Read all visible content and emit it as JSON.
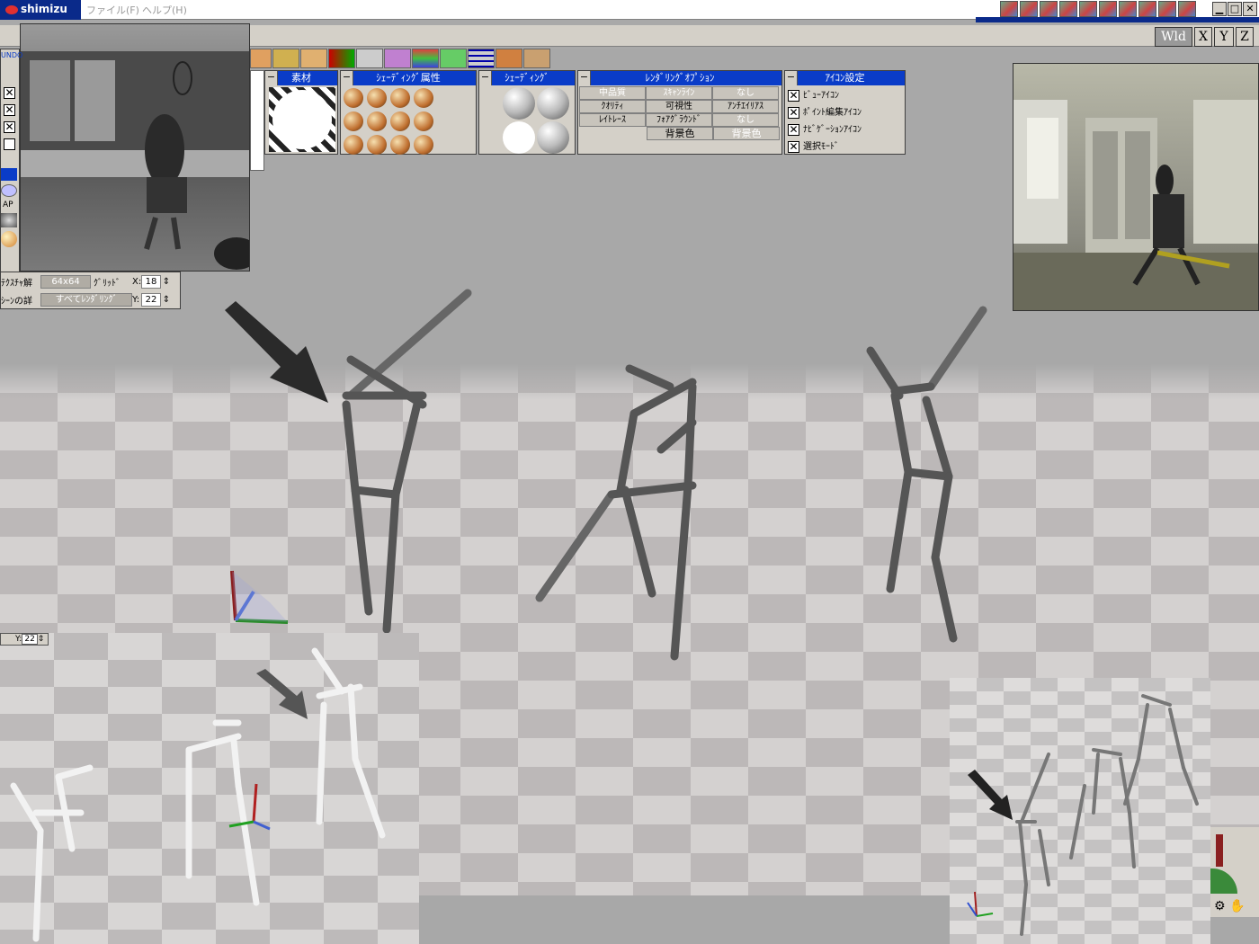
{
  "app": {
    "title": "shimizu"
  },
  "menu": {
    "file": "ファイル(F)",
    "help": "ヘルプ(H)"
  },
  "toolbar": {
    "undo_label": "UNDO",
    "axes": [
      "Wld",
      "X",
      "Y",
      "Z"
    ]
  },
  "panels": {
    "material": {
      "title": "素材"
    },
    "shading_attr": {
      "title": "ｼｪｰﾃﾞｨﾝｸﾞ属性"
    },
    "shading": {
      "title": "ｼｪｰﾃﾞｨﾝｸﾞ"
    },
    "render_options": {
      "title": "ﾚﾝﾀﾞﾘﾝｸﾞｵﾌﾟｼｮﾝ",
      "row1": [
        "中品質",
        "ｽｷｬﾝﾗｲﾝ",
        "なし"
      ],
      "row2": [
        "ｸｵﾘﾃｨ",
        "可視性",
        "ｱﾝﾁｴｲﾘｱｽ"
      ],
      "row3": [
        "ﾚｲﾄﾚｰｽ",
        "ﾌｫｱｸﾞﾗｳﾝﾄﾞ",
        "なし"
      ],
      "row4": [
        "背景色",
        "背景色"
      ]
    },
    "icon_settings": {
      "title": "ｱｲｺﾝ設定",
      "items": [
        {
          "label": "ﾋﾞｭｰｱｲｺﾝ",
          "checked": "✕"
        },
        {
          "label": "ﾎﾟｲﾝﾄ編集ｱｲｺﾝ",
          "checked": "✕"
        },
        {
          "label": "ﾅﾋﾞｹﾞｰｼｮﾝｱｲｺﾝ",
          "checked": "✕"
        },
        {
          "label": "選択ﾓｰﾄﾞ",
          "checked": "✕"
        }
      ]
    }
  },
  "left_panel": {
    "texture_label": "ﾃｸｽﾁｬ解",
    "texture_value": "64x64",
    "grid_label": "ｸﾞﾘｯﾄﾞ",
    "grid_x_label": "X:",
    "grid_x": "18",
    "scene_label": "ｼｰﾝの詳",
    "scene_value": "すべてﾚﾝﾀﾞﾘﾝｸﾞ",
    "grid_y_label": "Y:",
    "grid_y": "22",
    "ap_label": "AP"
  },
  "lower_left": {
    "y_label": "Y:",
    "y_value": "22"
  },
  "checks": [
    "✕",
    "✕",
    "✕"
  ],
  "colors": {
    "title_blue": "#0a3cc8",
    "panel_gray": "#d4d0c8",
    "viewport_gray": "#a8a8a8"
  }
}
